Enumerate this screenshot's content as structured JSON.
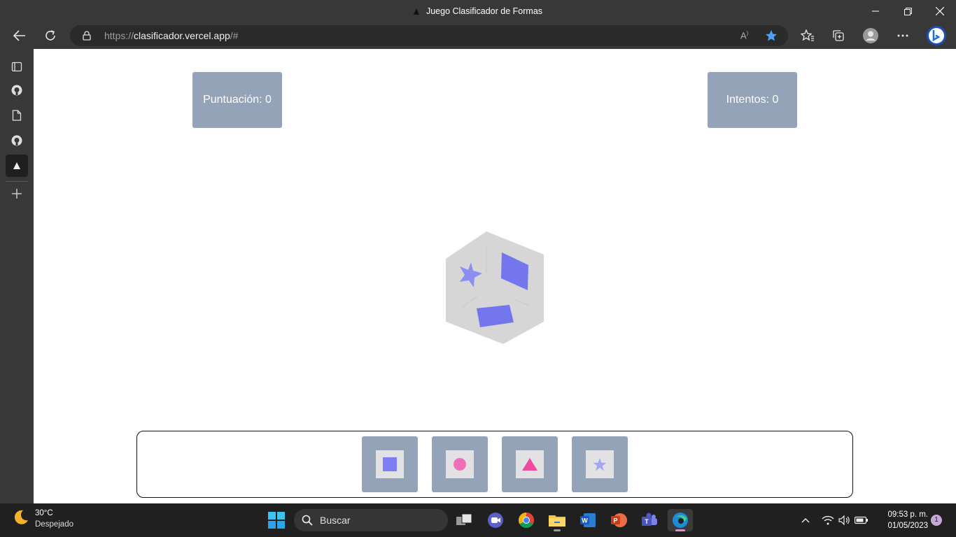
{
  "window": {
    "title": "Juego Clasificador de Formas"
  },
  "address_bar": {
    "scheme": "https://",
    "host": "clasificador.vercel.app",
    "path": "/#"
  },
  "page": {
    "score_label": "Puntuación: 0",
    "attempts_label": "Intentos: 0",
    "die_shapes": [
      "star",
      "square",
      "square"
    ],
    "sort_slots": [
      {
        "shape": "square",
        "color": "#7c7ef2"
      },
      {
        "shape": "circle",
        "color": "#f070b8"
      },
      {
        "shape": "triangle",
        "color": "#f04aa0"
      },
      {
        "shape": "star",
        "color": "#a5a4f5"
      }
    ]
  },
  "taskbar": {
    "weather_temp": "30°C",
    "weather_cond": "Despejado",
    "search_label": "Buscar",
    "time": "09:53 p. m.",
    "date": "01/05/2023",
    "notification_count": "1"
  },
  "colors": {
    "accent": "#4aa3ff",
    "score_box": "#94a3b8",
    "die": "#d6d6d6",
    "shape_blue": "#7c7ef2"
  }
}
